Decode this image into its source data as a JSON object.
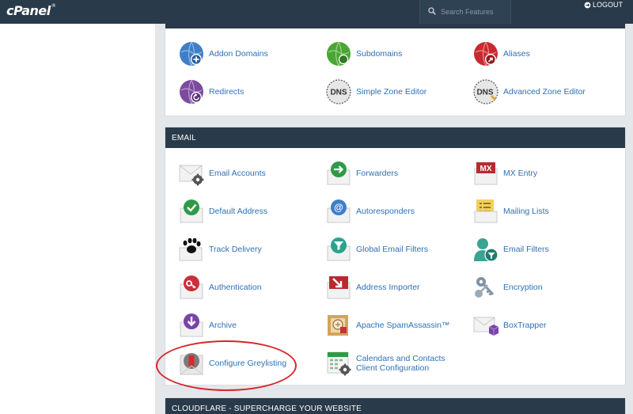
{
  "header": {
    "logo": "cPanel",
    "logo_mark": "®",
    "search_placeholder": "Search Features",
    "logout_label": "LOGOUT"
  },
  "domains": {
    "items": [
      {
        "label": "Addon Domains",
        "icon": "globe-plus-icon",
        "color": "#3f7fc8"
      },
      {
        "label": "Subdomains",
        "icon": "globe-subdomain-icon",
        "color": "#4aa534"
      },
      {
        "label": "Aliases",
        "icon": "globe-alias-icon",
        "color": "#c72b31"
      },
      {
        "label": "Redirects",
        "icon": "globe-redirect-icon",
        "color": "#7c4a9f"
      },
      {
        "label": "Simple Zone Editor",
        "icon": "dns-icon",
        "badge": "DNS"
      },
      {
        "label": "Advanced Zone Editor",
        "icon": "dns-advanced-icon",
        "badge": "DNS"
      }
    ]
  },
  "email": {
    "title": "EMAIL",
    "items": [
      {
        "label": "Email Accounts",
        "icon": "email-accounts-icon"
      },
      {
        "label": "Forwarders",
        "icon": "forwarders-icon"
      },
      {
        "label": "MX Entry",
        "icon": "mx-entry-icon",
        "badge": "MX"
      },
      {
        "label": "Default Address",
        "icon": "default-address-icon"
      },
      {
        "label": "Autoresponders",
        "icon": "autoresponders-icon",
        "badge": "@"
      },
      {
        "label": "Mailing Lists",
        "icon": "mailing-lists-icon"
      },
      {
        "label": "Track Delivery",
        "icon": "track-delivery-icon"
      },
      {
        "label": "Global Email Filters",
        "icon": "global-filters-icon"
      },
      {
        "label": "Email Filters",
        "icon": "email-filters-icon"
      },
      {
        "label": "Authentication",
        "icon": "authentication-icon"
      },
      {
        "label": "Address Importer",
        "icon": "address-importer-icon"
      },
      {
        "label": "Encryption",
        "icon": "encryption-icon"
      },
      {
        "label": "Archive",
        "icon": "archive-icon"
      },
      {
        "label": "Apache SpamAssassin™",
        "icon": "spamassassin-icon"
      },
      {
        "label": "BoxTrapper",
        "icon": "boxtrapper-icon"
      },
      {
        "label": "Configure Greylisting",
        "icon": "greylisting-icon"
      },
      {
        "label": "Calendars and Contacts",
        "label2": "Client Configuration",
        "icon": "calendars-icon"
      }
    ]
  },
  "cloudflare": {
    "title": "CLOUDFLARE - SUPERCHARGE YOUR WEBSITE"
  },
  "colors": {
    "topbar": "#293a4a",
    "link": "#2f71b4",
    "annotation": "#d6262b"
  }
}
